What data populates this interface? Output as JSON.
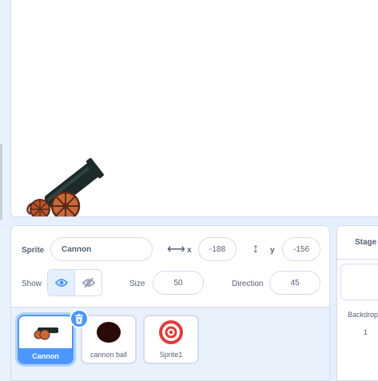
{
  "stage_canvas": {
    "sprite_visible": "cannon"
  },
  "sprite_info": {
    "sprite_label": "Sprite",
    "sprite_name": "Cannon",
    "x_label": "x",
    "x_value": "-188",
    "y_label": "y",
    "y_value": "-156",
    "show_label": "Show",
    "show_state": "visible",
    "size_label": "Size",
    "size_value": "50",
    "direction_label": "Direction",
    "direction_value": "45"
  },
  "sprites": [
    {
      "name": "Cannon",
      "selected": true,
      "icon": "cannon-icon"
    },
    {
      "name": "cannon ball",
      "selected": false,
      "icon": "cannon-ball-icon"
    },
    {
      "name": "Sprite1",
      "selected": false,
      "icon": "target-icon"
    }
  ],
  "stage_panel": {
    "header": "Stage",
    "backdrops_label": "Backdrops",
    "backdrops_count": "1"
  },
  "colors": {
    "accent": "#4c97ff",
    "text": "#575e75",
    "border": "#d5dceb",
    "panel_bg": "#e9f1fc"
  }
}
